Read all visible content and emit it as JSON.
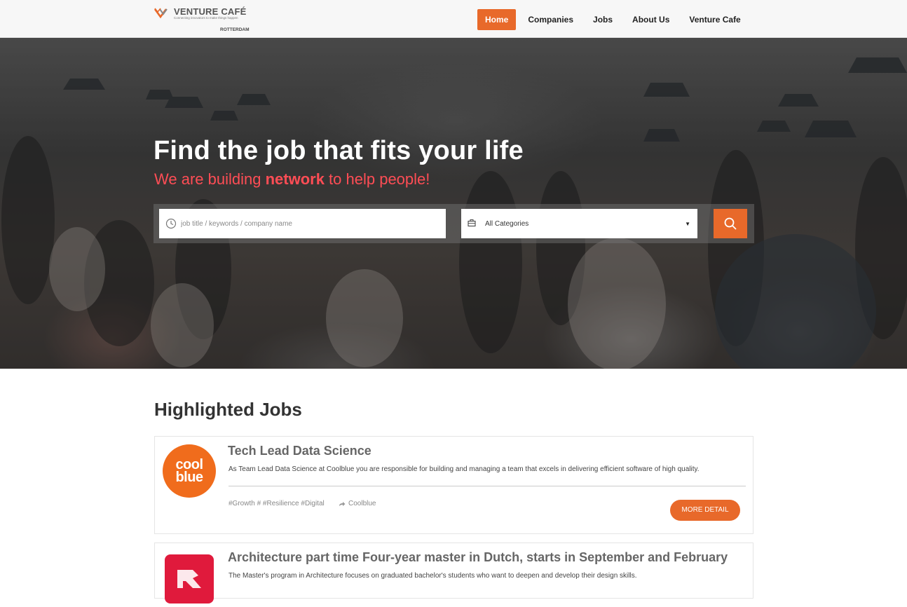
{
  "brand": {
    "name": "VENTURE CAFÉ",
    "tagline": "Connecting innovators to make things happen",
    "city": "ROTTERDAM",
    "accent": "#e8692a"
  },
  "nav": {
    "items": [
      {
        "label": "Home",
        "active": true
      },
      {
        "label": "Companies",
        "active": false
      },
      {
        "label": "Jobs",
        "active": false
      },
      {
        "label": "About Us",
        "active": false
      },
      {
        "label": "Venture Cafe",
        "active": false
      }
    ]
  },
  "hero": {
    "title": "Find the job that fits your life",
    "subtitle_before": "We are building ",
    "subtitle_bold": "network",
    "subtitle_after": " to help people!",
    "search_placeholder": "job title / keywords / company name",
    "category_selected": "All Categories",
    "icons": {
      "search_field": "clock-icon",
      "category": "briefcase-icon",
      "button": "search-icon"
    }
  },
  "jobs": {
    "section_title": "Highlighted Jobs",
    "items": [
      {
        "title": "Tech Lead Data Science",
        "description": "As Team Lead Data Science at Coolblue you are responsible for building and managing a team that excels in delivering efficient software of high quality.",
        "tags": "#Growth # #Resilience #Digital",
        "company": "Coolblue",
        "logo_line1": "cool",
        "logo_line2": "blue",
        "button": "MORE DETAIL"
      },
      {
        "title": "Architecture part time Four-year master in Dutch, starts in September and February",
        "description": "The Master's program in Architecture focuses on graduated bachelor's students who want to deepen and develop their design skills."
      }
    ]
  }
}
